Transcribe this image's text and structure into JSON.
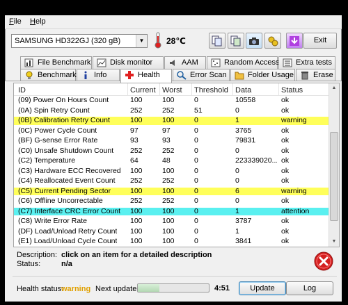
{
  "menu": {
    "file": "File",
    "file_u": "F",
    "file_rest": "ile",
    "help_u": "H",
    "help_rest": "elp"
  },
  "toolbar": {
    "drive": "SAMSUNG HD322GJ (320 gB)",
    "temperature": "28℃",
    "exit_label": "Exit",
    "icons": [
      "copy-icon",
      "copy-all-icon",
      "screenshot-icon",
      "tools-icon",
      "download-icon"
    ]
  },
  "tabs_top": [
    {
      "label": "File Benchmark",
      "icon": "file-benchmark-icon"
    },
    {
      "label": "Disk monitor",
      "icon": "disk-monitor-icon"
    },
    {
      "label": "AAM",
      "icon": "aam-icon"
    },
    {
      "label": "Random Access",
      "icon": "random-access-icon"
    },
    {
      "label": "Extra tests",
      "icon": "extra-tests-icon"
    }
  ],
  "tabs_bottom": [
    {
      "label": "Benchmark",
      "icon": "benchmark-icon"
    },
    {
      "label": "Info",
      "icon": "info-icon"
    },
    {
      "label": "Health",
      "icon": "health-icon"
    },
    {
      "label": "Error Scan",
      "icon": "error-scan-icon"
    },
    {
      "label": "Folder Usage",
      "icon": "folder-usage-icon"
    },
    {
      "label": "Erase",
      "icon": "erase-icon"
    }
  ],
  "table": {
    "columns": [
      "ID",
      "Current",
      "Worst",
      "Threshold",
      "Data",
      "Status"
    ],
    "rows": [
      [
        "(09) Power On Hours Count",
        "100",
        "100",
        "0",
        "10558",
        "ok"
      ],
      [
        "(0A) Spin Retry Count",
        "252",
        "252",
        "51",
        "0",
        "ok"
      ],
      [
        "(0B) Calibration Retry Count",
        "100",
        "100",
        "0",
        "1",
        "warning"
      ],
      [
        "(0C) Power Cycle Count",
        "97",
        "97",
        "0",
        "3765",
        "ok"
      ],
      [
        "(BF) G-sense Error Rate",
        "93",
        "93",
        "0",
        "79831",
        "ok"
      ],
      [
        "(C0) Unsafe Shutdown Count",
        "252",
        "252",
        "0",
        "0",
        "ok"
      ],
      [
        "(C2) Temperature",
        "64",
        "48",
        "0",
        "223339020...",
        "ok"
      ],
      [
        "(C3) Hardware ECC Recovered",
        "100",
        "100",
        "0",
        "0",
        "ok"
      ],
      [
        "(C4) Reallocated Event Count",
        "252",
        "252",
        "0",
        "0",
        "ok"
      ],
      [
        "(C5) Current Pending Sector",
        "100",
        "100",
        "0",
        "6",
        "warning"
      ],
      [
        "(C6) Offline Uncorrectable",
        "252",
        "252",
        "0",
        "0",
        "ok"
      ],
      [
        "(C7) Interface CRC Error Count",
        "100",
        "100",
        "0",
        "1",
        "attention"
      ],
      [
        "(C8) Write Error Rate",
        "100",
        "100",
        "0",
        "3787",
        "ok"
      ],
      [
        "(DF) Load/Unload Retry Count",
        "100",
        "100",
        "0",
        "1",
        "ok"
      ],
      [
        "(E1) Load/Unload Cycle Count",
        "100",
        "100",
        "0",
        "3841",
        "ok"
      ]
    ],
    "highlight_colors": {
      "warning": "#ffff5a",
      "attention": "#5af0f0"
    }
  },
  "description": {
    "desc_label": "Description:",
    "desc_value": "click on an item for a detailed description",
    "status_label": "Status:",
    "status_value": "n/a"
  },
  "footer": {
    "health_label": "Health status:",
    "health_value": "warning",
    "next_update_label": "Next update:",
    "progress": 0.3,
    "timer": "4:51",
    "update_label": "Update",
    "log_label": "Log"
  }
}
